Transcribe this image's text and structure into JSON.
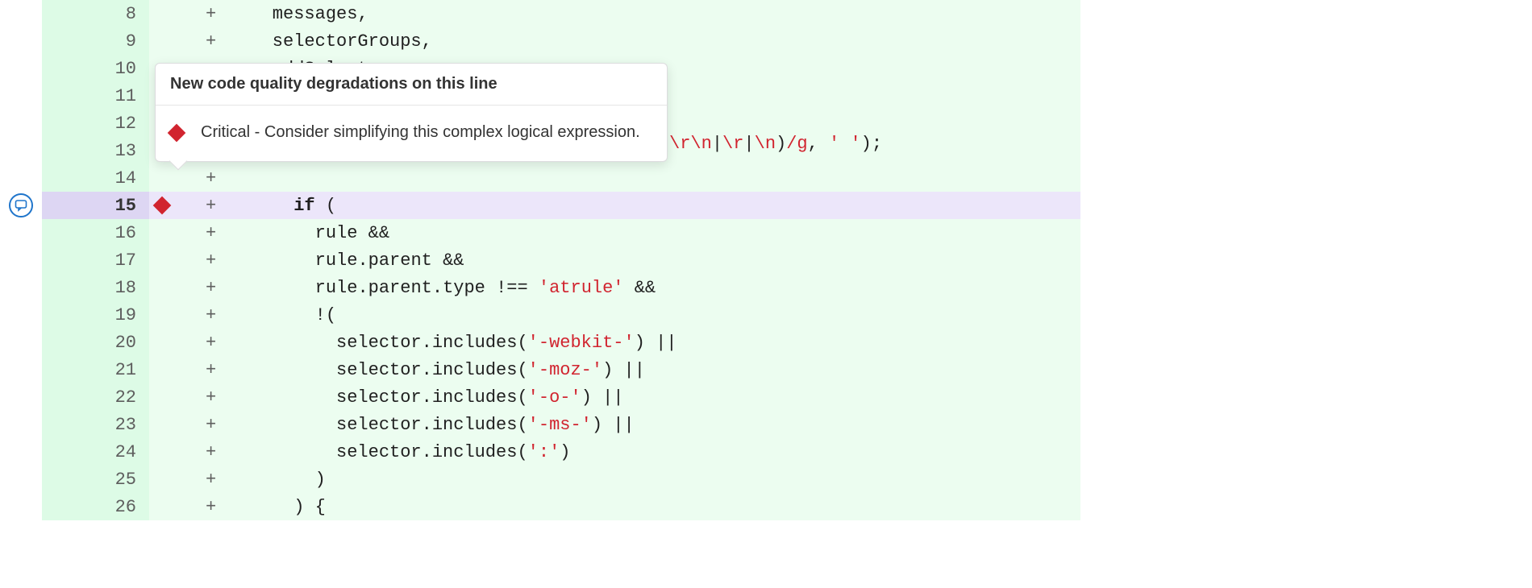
{
  "tooltip": {
    "title": "New code quality degradations on this line",
    "severity": "Critical",
    "message": "Consider simplifying this complex logical expression."
  },
  "colors": {
    "added_bg": "#ecfdf0",
    "added_gutter_bg": "#ddfbe6",
    "highlight_bg": "#ece6fa",
    "highlight_gutter_bg": "#ddd6f3",
    "critical": "#d1242f",
    "accent": "#1f75cb"
  },
  "rows": [
    {
      "n": "8",
      "sign": "+",
      "marker": false,
      "highlight": false,
      "showComment": false,
      "tokens": [
        {
          "cls": "",
          "t": "    messages"
        },
        {
          "cls": "op",
          "t": ","
        }
      ]
    },
    {
      "n": "9",
      "sign": "+",
      "marker": false,
      "highlight": false,
      "showComment": false,
      "tokens": [
        {
          "cls": "",
          "t": "    selectorGroups"
        },
        {
          "cls": "op",
          "t": ","
        }
      ]
    },
    {
      "n": "10",
      "sign": "+",
      "marker": false,
      "highlight": false,
      "showComment": false,
      "tokens": [
        {
          "cls": "",
          "t": "    addSelectors"
        },
        {
          "cls": "op",
          "t": ","
        }
      ]
    },
    {
      "n": "11",
      "sign": "+",
      "marker": false,
      "highlight": false,
      "showComment": false,
      "tokens": []
    },
    {
      "n": "12",
      "sign": "+",
      "marker": false,
      "highlight": false,
      "showComment": false,
      "tokens": []
    },
    {
      "n": "13",
      "sign": "+",
      "marker": false,
      "highlight": false,
      "showComment": false,
      "tokens": []
    },
    {
      "n": "14",
      "sign": "+",
      "marker": false,
      "highlight": false,
      "showComment": false,
      "tokens": []
    },
    {
      "n": "15",
      "sign": "+",
      "marker": true,
      "highlight": true,
      "showComment": true,
      "tokens": [
        {
          "cls": "",
          "t": "      "
        },
        {
          "cls": "kw",
          "t": "if"
        },
        {
          "cls": "",
          "t": " "
        },
        {
          "cls": "op",
          "t": "("
        }
      ]
    },
    {
      "n": "16",
      "sign": "+",
      "marker": false,
      "highlight": false,
      "showComment": false,
      "tokens": [
        {
          "cls": "",
          "t": "        rule "
        },
        {
          "cls": "op",
          "t": "&&"
        }
      ]
    },
    {
      "n": "17",
      "sign": "+",
      "marker": false,
      "highlight": false,
      "showComment": false,
      "tokens": [
        {
          "cls": "",
          "t": "        rule"
        },
        {
          "cls": "op",
          "t": "."
        },
        {
          "cls": "",
          "t": "parent "
        },
        {
          "cls": "op",
          "t": "&&"
        }
      ]
    },
    {
      "n": "18",
      "sign": "+",
      "marker": false,
      "highlight": false,
      "showComment": false,
      "tokens": [
        {
          "cls": "",
          "t": "        rule"
        },
        {
          "cls": "op",
          "t": "."
        },
        {
          "cls": "",
          "t": "parent"
        },
        {
          "cls": "op",
          "t": "."
        },
        {
          "cls": "",
          "t": "type "
        },
        {
          "cls": "op",
          "t": "!=="
        },
        {
          "cls": "",
          "t": " "
        },
        {
          "cls": "str",
          "t": "'atrule'"
        },
        {
          "cls": "",
          "t": " "
        },
        {
          "cls": "op",
          "t": "&&"
        }
      ]
    },
    {
      "n": "19",
      "sign": "+",
      "marker": false,
      "highlight": false,
      "showComment": false,
      "tokens": [
        {
          "cls": "",
          "t": "        "
        },
        {
          "cls": "op",
          "t": "!("
        }
      ]
    },
    {
      "n": "20",
      "sign": "+",
      "marker": false,
      "highlight": false,
      "showComment": false,
      "tokens": [
        {
          "cls": "",
          "t": "          selector"
        },
        {
          "cls": "op",
          "t": "."
        },
        {
          "cls": "",
          "t": "includes"
        },
        {
          "cls": "op",
          "t": "("
        },
        {
          "cls": "str",
          "t": "'-webkit-'"
        },
        {
          "cls": "op",
          "t": ")"
        },
        {
          "cls": "",
          "t": " "
        },
        {
          "cls": "op",
          "t": "||"
        }
      ]
    },
    {
      "n": "21",
      "sign": "+",
      "marker": false,
      "highlight": false,
      "showComment": false,
      "tokens": [
        {
          "cls": "",
          "t": "          selector"
        },
        {
          "cls": "op",
          "t": "."
        },
        {
          "cls": "",
          "t": "includes"
        },
        {
          "cls": "op",
          "t": "("
        },
        {
          "cls": "str",
          "t": "'-moz-'"
        },
        {
          "cls": "op",
          "t": ")"
        },
        {
          "cls": "",
          "t": " "
        },
        {
          "cls": "op",
          "t": "||"
        }
      ]
    },
    {
      "n": "22",
      "sign": "+",
      "marker": false,
      "highlight": false,
      "showComment": false,
      "tokens": [
        {
          "cls": "",
          "t": "          selector"
        },
        {
          "cls": "op",
          "t": "."
        },
        {
          "cls": "",
          "t": "includes"
        },
        {
          "cls": "op",
          "t": "("
        },
        {
          "cls": "str",
          "t": "'-o-'"
        },
        {
          "cls": "op",
          "t": ")"
        },
        {
          "cls": "",
          "t": " "
        },
        {
          "cls": "op",
          "t": "||"
        }
      ]
    },
    {
      "n": "23",
      "sign": "+",
      "marker": false,
      "highlight": false,
      "showComment": false,
      "tokens": [
        {
          "cls": "",
          "t": "          selector"
        },
        {
          "cls": "op",
          "t": "."
        },
        {
          "cls": "",
          "t": "includes"
        },
        {
          "cls": "op",
          "t": "("
        },
        {
          "cls": "str",
          "t": "'-ms-'"
        },
        {
          "cls": "op",
          "t": ")"
        },
        {
          "cls": "",
          "t": " "
        },
        {
          "cls": "op",
          "t": "||"
        }
      ]
    },
    {
      "n": "24",
      "sign": "+",
      "marker": false,
      "highlight": false,
      "showComment": false,
      "tokens": [
        {
          "cls": "",
          "t": "          selector"
        },
        {
          "cls": "op",
          "t": "."
        },
        {
          "cls": "",
          "t": "includes"
        },
        {
          "cls": "op",
          "t": "("
        },
        {
          "cls": "str",
          "t": "':'"
        },
        {
          "cls": "op",
          "t": ")"
        }
      ]
    },
    {
      "n": "25",
      "sign": "+",
      "marker": false,
      "highlight": false,
      "showComment": false,
      "tokens": [
        {
          "cls": "",
          "t": "        "
        },
        {
          "cls": "op",
          "t": ")"
        }
      ]
    },
    {
      "n": "26",
      "sign": "+",
      "marker": false,
      "highlight": false,
      "showComment": false,
      "tokens": [
        {
          "cls": "",
          "t": "      "
        },
        {
          "cls": "op",
          "t": ")"
        },
        {
          "cls": "",
          "t": " "
        },
        {
          "cls": "op",
          "t": "{"
        }
      ]
    }
  ],
  "behind_tokens": [
    {
      "cls": "rx",
      "t": "\\r\\n"
    },
    {
      "cls": "op",
      "t": "|"
    },
    {
      "cls": "rx",
      "t": "\\r"
    },
    {
      "cls": "op",
      "t": "|"
    },
    {
      "cls": "rx",
      "t": "\\n"
    },
    {
      "cls": "op",
      "t": ")"
    },
    {
      "cls": "rxf",
      "t": "/g"
    },
    {
      "cls": "op",
      "t": ","
    },
    {
      "cls": "",
      "t": " "
    },
    {
      "cls": "str",
      "t": "' '"
    },
    {
      "cls": "op",
      "t": ")"
    },
    {
      "cls": "op",
      "t": ";"
    }
  ]
}
